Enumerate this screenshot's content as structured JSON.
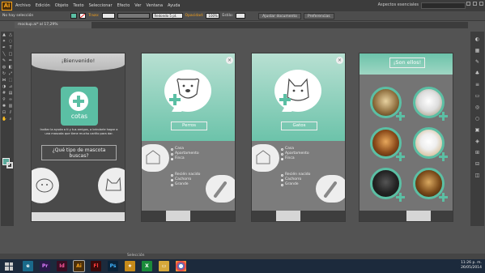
{
  "app": {
    "logo": "Ai"
  },
  "menu": [
    "Archivo",
    "Edición",
    "Objeto",
    "Texto",
    "Seleccionar",
    "Efecto",
    "Ver",
    "Ventana",
    "Ayuda"
  ],
  "workspace": "Aspectos esenciales",
  "control": {
    "selection": "No hay selección",
    "trazo": "Trazo:",
    "brush": "Redondo 5 pt.",
    "opacidad": "Opacidad:",
    "opacity_value": "100%",
    "estilo": "Estilo:",
    "ajustar": "Ajustar documento",
    "preferencias": "Preferencias"
  },
  "doc_tab": "mockup.ai* al 17,29% (RGB/Previsualizar)",
  "status": {
    "label": "Selección"
  },
  "artboards": {
    "welcome": {
      "title": "¡Bienvenido!",
      "logo": "cotas",
      "description": "Invitar la ayuda a ti y tus amigos, a brindarle hogar a una mascota que tiene mucho cariño para dar.",
      "question": "¿Qué tipo de mascota buscas?"
    },
    "dogs": {
      "caption": "Perros",
      "housing": [
        "Casa",
        "Apartamento",
        "Finca"
      ],
      "age": [
        "Recién nacido",
        "Cachorro",
        "Grande"
      ],
      "housing_selected": 2,
      "age_selected": 1
    },
    "cats": {
      "caption": "Gatos",
      "housing": [
        "Casa",
        "Apartamento",
        "Finca"
      ],
      "age": [
        "Recién nacido",
        "Cachorro",
        "Grande"
      ],
      "housing_selected": 2,
      "age_selected": 1
    },
    "results": {
      "title": "¡Son ellos!"
    }
  },
  "taskbar": {
    "apps": [
      {
        "label": "Pr",
        "color": "#2b1a4a",
        "fg": "#e07cff"
      },
      {
        "label": "Id",
        "color": "#3a0d22",
        "fg": "#ff5aa0"
      },
      {
        "label": "Ai",
        "color": "#4a2f0c",
        "fg": "#f7a21b"
      },
      {
        "label": "Fl",
        "color": "#3a0a0a",
        "fg": "#ff3c3c"
      },
      {
        "label": "Ps",
        "color": "#0a2238",
        "fg": "#3fb4ff"
      }
    ],
    "time": "11:26 p. m.",
    "date": "26/05/2014"
  },
  "colors": {
    "accent": "#5bbfa4"
  }
}
